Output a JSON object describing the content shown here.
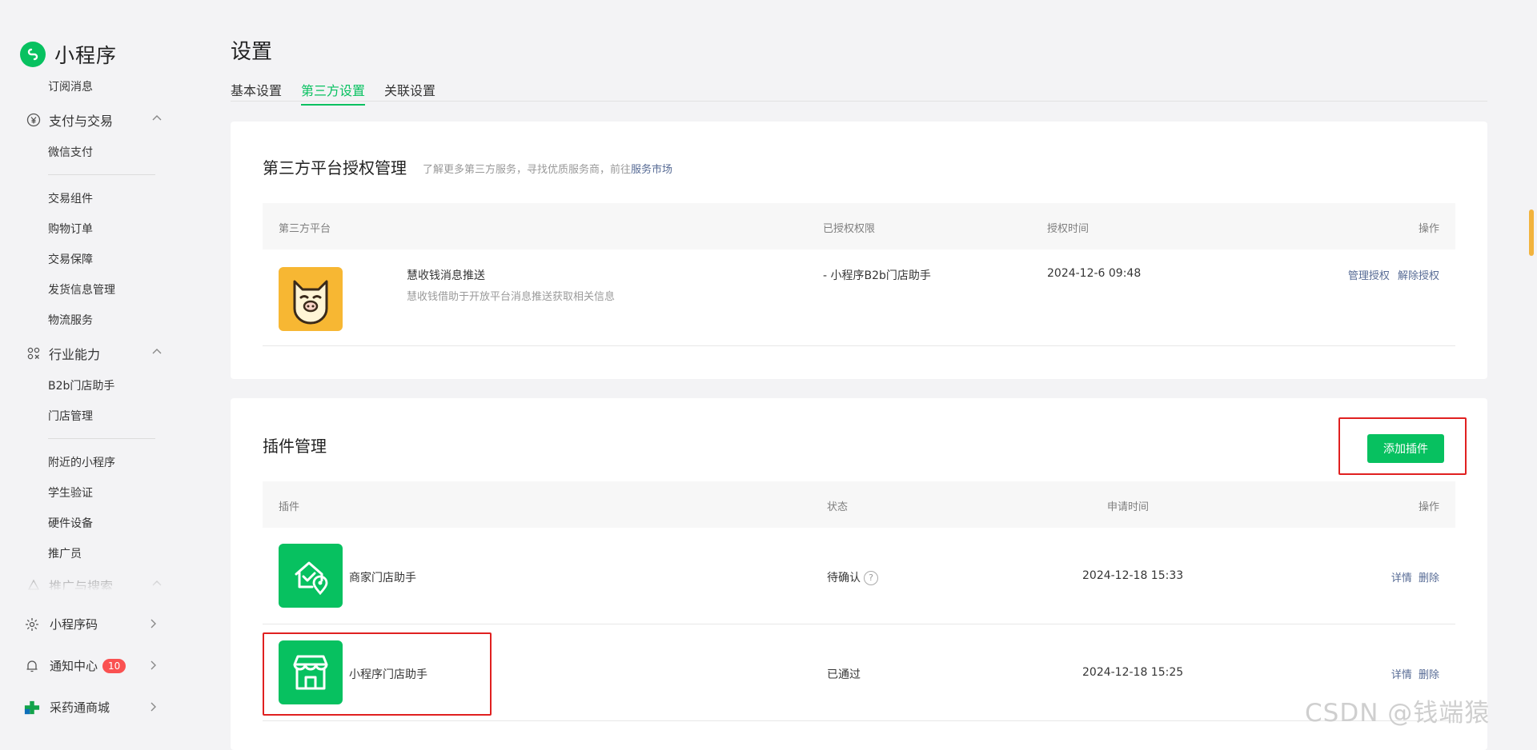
{
  "app": {
    "name": "小程序"
  },
  "sidebar": {
    "items": [
      {
        "label": "订阅消息"
      },
      {
        "label": "支付与交易",
        "group": true
      },
      {
        "label": "微信支付"
      },
      {
        "label": "交易组件"
      },
      {
        "label": "购物订单"
      },
      {
        "label": "交易保障"
      },
      {
        "label": "发货信息管理"
      },
      {
        "label": "物流服务"
      },
      {
        "label": "行业能力",
        "group": true
      },
      {
        "label": "B2b门店助手"
      },
      {
        "label": "门店管理"
      },
      {
        "label": "附近的小程序"
      },
      {
        "label": "学生验证"
      },
      {
        "label": "硬件设备"
      },
      {
        "label": "推广员"
      },
      {
        "label": "推广与搜索",
        "group": true
      }
    ],
    "bottom": [
      {
        "label": "小程序码",
        "icon": "sparkle-icon"
      },
      {
        "label": "通知中心",
        "icon": "bell-icon",
        "badge": "10"
      },
      {
        "label": "采药通商城",
        "icon": "medical-cross-icon"
      }
    ]
  },
  "header": {
    "title": "设置",
    "tabs": [
      {
        "label": "基本设置"
      },
      {
        "label": "第三方设置",
        "active": true
      },
      {
        "label": "关联设置"
      }
    ]
  },
  "third_party": {
    "title": "第三方平台授权管理",
    "desc_prefix": "了解更多第三方服务，寻找优质服务商，前往",
    "desc_link": "服务市场",
    "columns": [
      "第三方平台",
      "已授权权限",
      "授权时间",
      "操作"
    ],
    "rows": [
      {
        "name": "慧收钱消息推送",
        "desc": "慧收钱借助于开放平台消息推送获取相关信息",
        "permission": "- 小程序B2b门店助手",
        "time": "2024-12-6 09:48",
        "actions": [
          "管理授权",
          "解除授权"
        ],
        "logo_icon": "pig-face-icon",
        "logo_color": "#f7b733"
      }
    ]
  },
  "plugins": {
    "title": "插件管理",
    "add_button": "添加插件",
    "columns": [
      "插件",
      "状态",
      "申请时间",
      "操作"
    ],
    "rows": [
      {
        "name": "商家门店助手",
        "status": "待确认",
        "time": "2024-12-18 15:33",
        "actions": [
          "详情",
          "删除"
        ],
        "icon": "house-location-icon"
      },
      {
        "name": "小程序门店助手",
        "status": "已通过",
        "time": "2024-12-18 15:25",
        "actions": [
          "详情",
          "删除"
        ],
        "icon": "storefront-icon"
      }
    ]
  },
  "watermark": "CSDN @钱端猿",
  "colors": {
    "brand": "#07c160",
    "link": "#576b95",
    "badge": "#fa5151",
    "highlight": "#e02020"
  }
}
